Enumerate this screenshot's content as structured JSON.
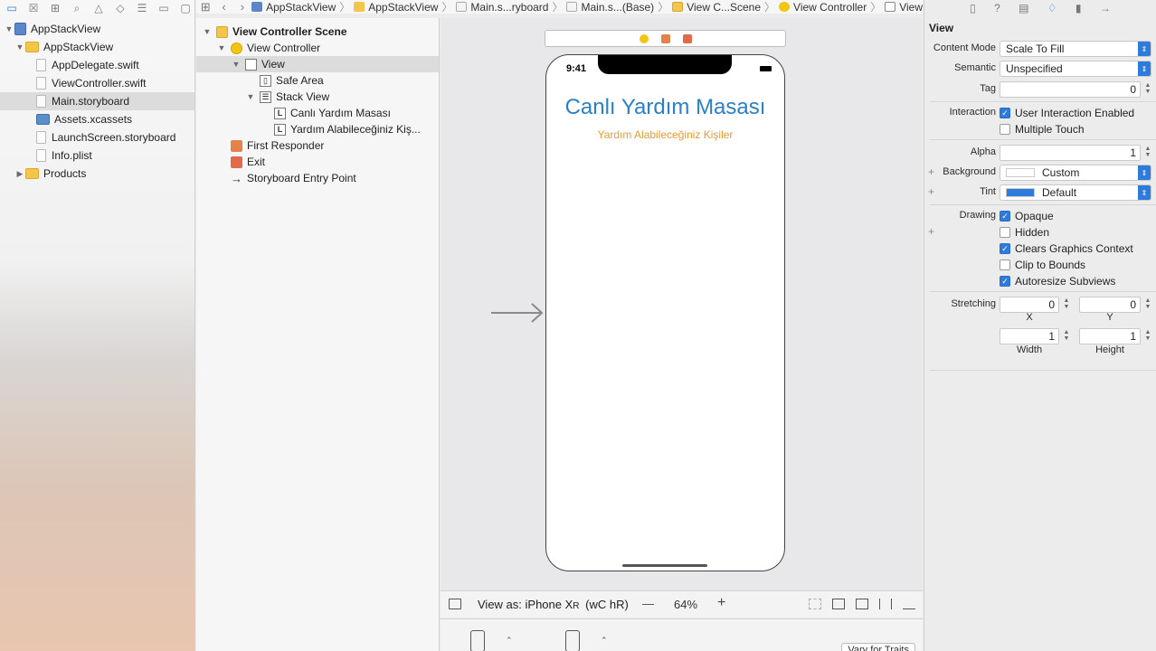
{
  "navigator": {
    "toolbar_icons": [
      "folder-icon",
      "source-control-icon",
      "symbol-icon",
      "find-icon",
      "issue-icon",
      "test-icon",
      "debug-icon",
      "breakpoint-icon",
      "report-icon"
    ],
    "items": [
      {
        "label": "AppStackView",
        "type": "project",
        "level": 0,
        "expanded": true
      },
      {
        "label": "AppStackView",
        "type": "folder",
        "level": 1,
        "expanded": true
      },
      {
        "label": "AppDelegate.swift",
        "type": "file",
        "level": 2
      },
      {
        "label": "ViewController.swift",
        "type": "file",
        "level": 2
      },
      {
        "label": "Main.storyboard",
        "type": "file",
        "level": 2,
        "selected": true
      },
      {
        "label": "Assets.xcassets",
        "type": "folder-blue",
        "level": 2
      },
      {
        "label": "LaunchScreen.storyboard",
        "type": "file",
        "level": 2
      },
      {
        "label": "Info.plist",
        "type": "file",
        "level": 2
      },
      {
        "label": "Products",
        "type": "folder",
        "level": 1,
        "expanded": false
      }
    ]
  },
  "jumpbar": {
    "crumbs": [
      {
        "label": "AppStackView",
        "icon": "proj"
      },
      {
        "label": "AppStackView",
        "icon": "folder"
      },
      {
        "label": "Main.s...ryboard",
        "icon": "file"
      },
      {
        "label": "Main.s...(Base)",
        "icon": "file"
      },
      {
        "label": "View C...Scene",
        "icon": "scene"
      },
      {
        "label": "View Controller",
        "icon": "vc"
      },
      {
        "label": "View",
        "icon": "view"
      }
    ]
  },
  "outline": {
    "items": [
      {
        "label": "View Controller Scene",
        "icon": "scene",
        "level": 0,
        "disclosure": "open",
        "bold": true
      },
      {
        "label": "View Controller",
        "icon": "vc",
        "level": 1,
        "disclosure": "open"
      },
      {
        "label": "View",
        "icon": "view",
        "level": 2,
        "disclosure": "open",
        "selected": true
      },
      {
        "label": "Safe Area",
        "icon": "safe",
        "level": 3
      },
      {
        "label": "Stack View",
        "icon": "stack",
        "level": 3,
        "disclosure": "open"
      },
      {
        "label": "Canlı Yardım Masası",
        "icon": "label",
        "level": 4
      },
      {
        "label": "Yardım Alabileceğiniz Kiş...",
        "icon": "label",
        "level": 4
      },
      {
        "label": "First Responder",
        "icon": "fr",
        "level": 1
      },
      {
        "label": "Exit",
        "icon": "exit",
        "level": 1
      },
      {
        "label": "Storyboard Entry Point",
        "icon": "arrow",
        "level": 1
      }
    ]
  },
  "canvas": {
    "status_time": "9:41",
    "title_label": "Canlı Yardım Masası",
    "subtitle_label": "Yardım Alabileceğiniz Kişiler",
    "title_color": "#2b80c5",
    "subtitle_color": "#e89b2f",
    "view_as_prefix": "View as: iPhone X",
    "view_as_model": "R",
    "view_as_traits": "(wC hR)",
    "zoom": "64%",
    "zoom_out": "—",
    "zoom_in": "+",
    "vary_for_traits": "Vary for Traits"
  },
  "inspector": {
    "header": "View",
    "content_mode_label": "Content Mode",
    "content_mode": "Scale To Fill",
    "semantic_label": "Semantic",
    "semantic": "Unspecified",
    "tag_label": "Tag",
    "tag": "0",
    "interaction_label": "Interaction",
    "user_interaction": "User Interaction Enabled",
    "multiple_touch": "Multiple Touch",
    "alpha_label": "Alpha",
    "alpha": "1",
    "background_label": "Background",
    "background": "Custom",
    "tint_label": "Tint",
    "tint": "Default",
    "tint_color": "#2f7bdc",
    "drawing_label": "Drawing",
    "opaque": "Opaque",
    "hidden": "Hidden",
    "clears_graphics": "Clears Graphics Context",
    "clip_to_bounds": "Clip to Bounds",
    "autoresize": "Autoresize Subviews",
    "stretching_label": "Stretching",
    "stretch_x": "0",
    "stretch_y": "0",
    "stretch_w": "1",
    "stretch_h": "1",
    "x_label": "X",
    "y_label": "Y",
    "width_label": "Width",
    "height_label": "Height",
    "checks": {
      "user_interaction": true,
      "multiple_touch": false,
      "opaque": true,
      "hidden": false,
      "clears_graphics": true,
      "clip_to_bounds": false,
      "autoresize": true
    }
  }
}
